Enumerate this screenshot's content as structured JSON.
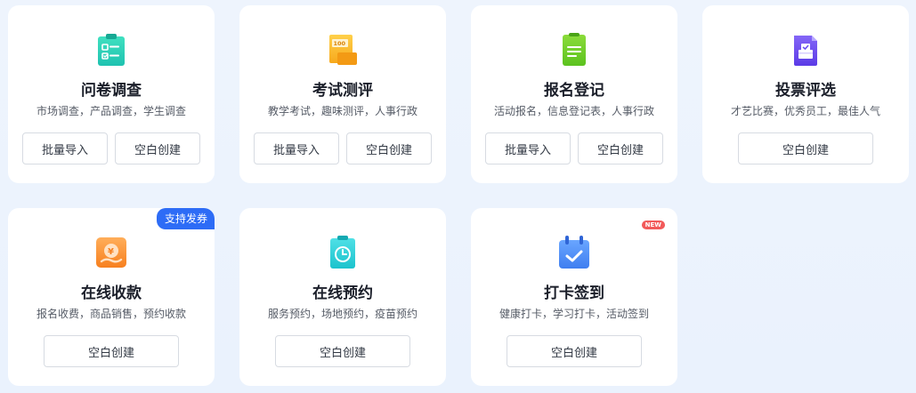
{
  "cards": [
    {
      "title": "问卷调查",
      "desc": "市场调查，产品调查，学生调查",
      "buttons": [
        "批量导入",
        "空白创建"
      ],
      "icon": "survey-icon",
      "color": "#2fd2b4"
    },
    {
      "title": "考试测评",
      "desc": "教学考试，趣味测评，人事行政",
      "buttons": [
        "批量导入",
        "空白创建"
      ],
      "icon": "exam-icon",
      "color": "#f6b21c"
    },
    {
      "title": "报名登记",
      "desc": "活动报名，信息登记表，人事行政",
      "buttons": [
        "批量导入",
        "空白创建"
      ],
      "icon": "registration-icon",
      "color": "#67c925"
    },
    {
      "title": "投票评选",
      "desc": "才艺比赛，优秀员工，最佳人气",
      "buttons": [
        "空白创建"
      ],
      "icon": "vote-icon",
      "color": "#6b4ef0"
    },
    {
      "title": "在线收款",
      "desc": "报名收费，商品销售，预约收款",
      "buttons": [
        "空白创建"
      ],
      "icon": "payment-icon",
      "color": "#fb8a36",
      "badge": "支持发券"
    },
    {
      "title": "在线预约",
      "desc": "服务预约，场地预约，疫苗预约",
      "buttons": [
        "空白创建"
      ],
      "icon": "appointment-icon",
      "color": "#2fd0d8"
    },
    {
      "title": "打卡签到",
      "desc": "健康打卡，学习打卡，活动签到",
      "buttons": [
        "空白创建"
      ],
      "icon": "checkin-icon",
      "color": "#4f8df5",
      "new_badge": "NEW"
    }
  ]
}
